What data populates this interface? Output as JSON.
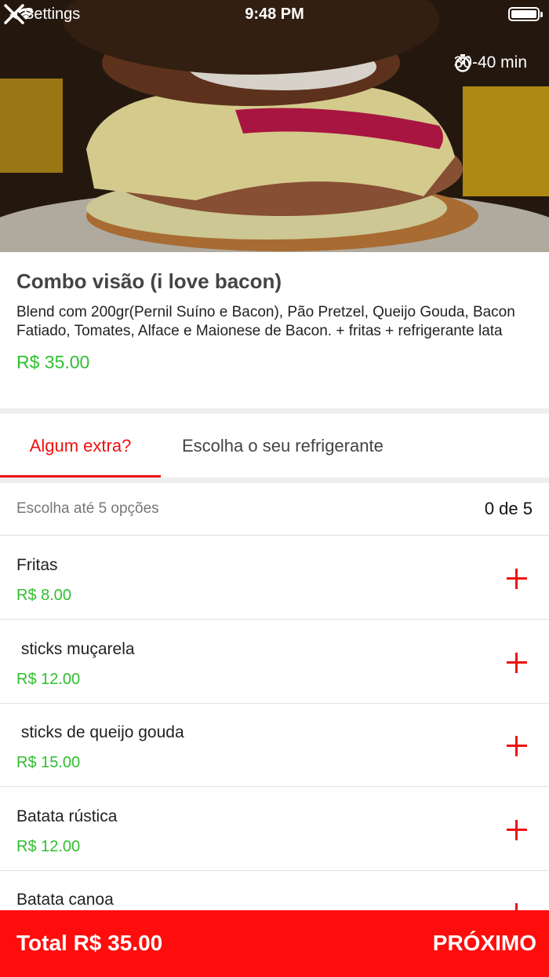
{
  "status_bar": {
    "back_label": "Settings",
    "time": "9:48 PM"
  },
  "header": {
    "eta": "30-40 min",
    "close_icon": "close-icon",
    "timer_icon": "stopwatch-icon"
  },
  "product": {
    "title": "Combo visão (i love bacon)",
    "description": "Blend com 200gr(Pernil Suíno e Bacon), Pão Pretzel, Queijo Gouda, Bacon Fatiado, Tomates, Alface e Maionese de Bacon. + fritas + refrigerante lata",
    "price": "R$ 35.00"
  },
  "tabs": [
    {
      "label": "Algum extra?",
      "active": true
    },
    {
      "label": "Escolha o seu refrigerante",
      "active": false
    }
  ],
  "extras": {
    "instruction": "Escolha até 5 opções",
    "count": "0 de 5",
    "options": [
      {
        "name": "Fritas",
        "price": "R$ 8.00"
      },
      {
        "name": " sticks muçarela",
        "price": "R$ 12.00"
      },
      {
        "name": " sticks de queijo gouda",
        "price": "R$ 15.00"
      },
      {
        "name": "Batata rústica",
        "price": "R$ 12.00"
      },
      {
        "name": "Batata canoa",
        "price": ""
      }
    ]
  },
  "footer": {
    "total": "Total R$ 35.00",
    "next": "PRÓXIMO"
  },
  "colors": {
    "accent": "#ee1111",
    "price_green": "#2fbf2f",
    "footer_bg": "#ff0d0d"
  }
}
